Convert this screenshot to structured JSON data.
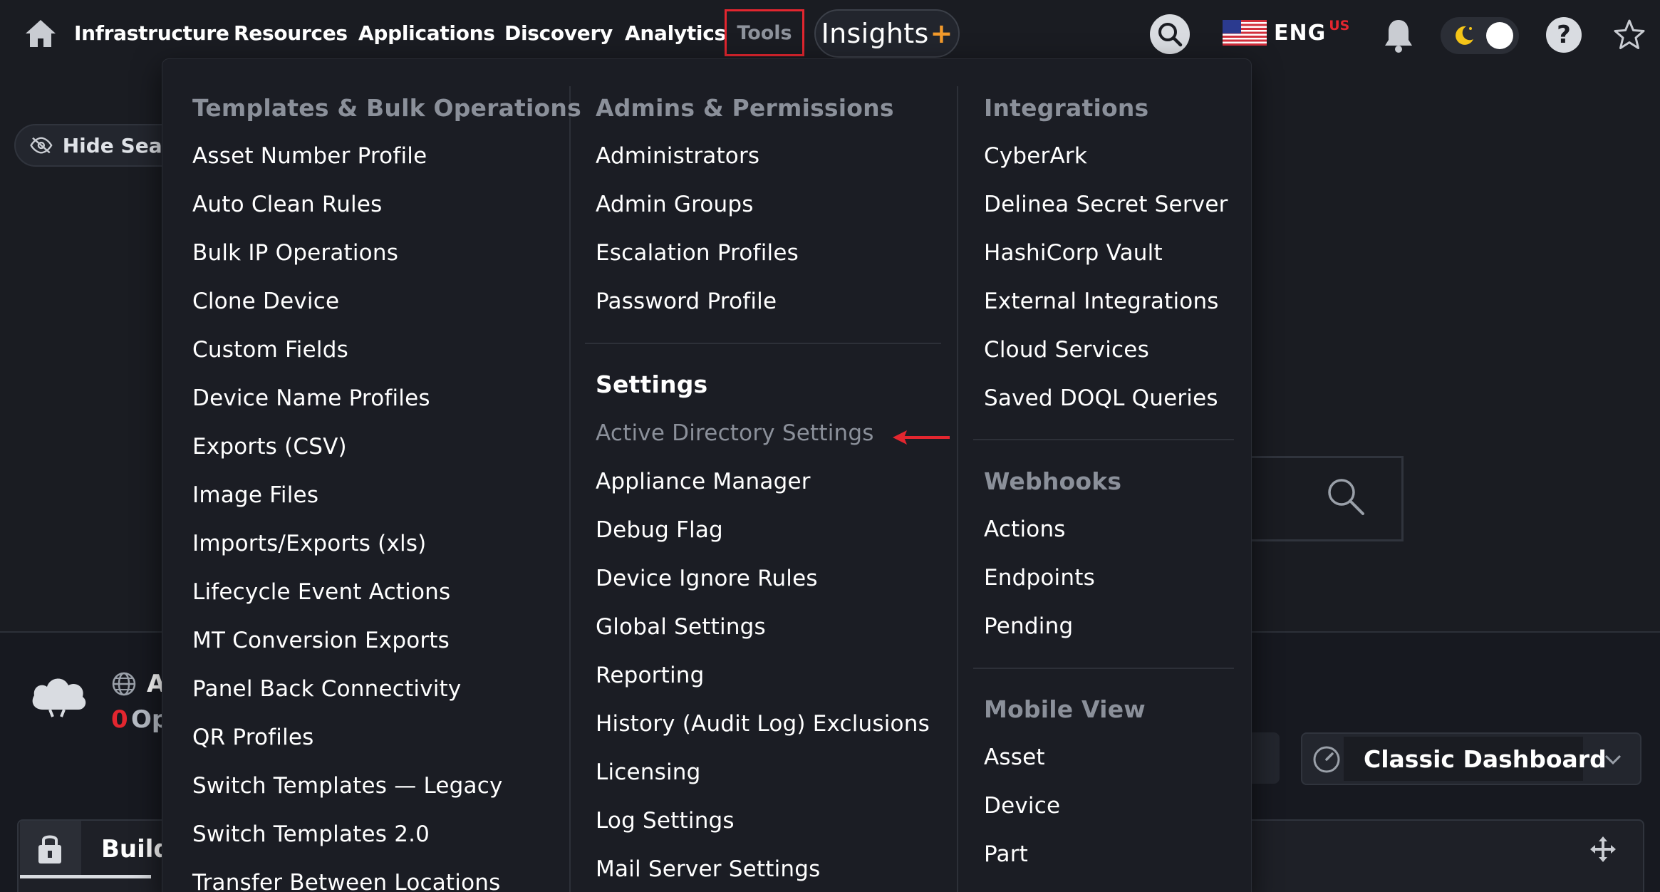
{
  "nav": {
    "items": [
      "Infrastructure",
      "Resources",
      "Applications",
      "Discovery",
      "Analytics"
    ],
    "tools_label": "Tools",
    "insights_label": "Insights",
    "insights_plus": "+",
    "language": "ENG",
    "region": "US",
    "help_glyph": "?"
  },
  "colors": {
    "accent_red": "#e3262f",
    "insights_plus": "#f39a2b",
    "background": "#1a1c22",
    "menu_header": "#8b909a"
  },
  "background": {
    "hide_search_label": "Hide Searc",
    "partial_title": "A",
    "count_value": "0",
    "count_label": "Op",
    "dashboard_label": "Classic Dashboard",
    "build_label": "Build"
  },
  "menu": {
    "col1": {
      "header": "Templates & Bulk Operations",
      "items": [
        "Asset Number Profile",
        "Auto Clean Rules",
        "Bulk IP Operations",
        "Clone Device",
        "Custom Fields",
        "Device Name Profiles",
        "Exports (CSV)",
        "Image Files",
        "Imports/Exports (xls)",
        "Lifecycle Event Actions",
        "MT Conversion Exports",
        "Panel Back Connectivity",
        "QR Profiles",
        "Switch Templates — Legacy",
        "Switch Templates 2.0",
        "Transfer Between Locations"
      ]
    },
    "col2": {
      "header": "Admins & Permissions",
      "items": [
        "Administrators",
        "Admin Groups",
        "Escalation Profiles",
        "Password Profile"
      ],
      "settings_header": "Settings",
      "settings_highlight": "Active Directory Settings",
      "settings_items": [
        "Appliance Manager",
        "Debug Flag",
        "Device Ignore Rules",
        "Global Settings",
        "Reporting",
        "History (Audit Log) Exclusions",
        "Licensing",
        "Log Settings",
        "Mail Server Settings"
      ]
    },
    "col3": {
      "header": "Integrations",
      "items": [
        "CyberArk",
        "Delinea Secret Server",
        "HashiCorp Vault",
        "External Integrations",
        "Cloud Services",
        "Saved DOQL Queries"
      ],
      "webhooks_header": "Webhooks",
      "webhooks_items": [
        "Actions",
        "Endpoints",
        "Pending"
      ],
      "mobile_header": "Mobile View",
      "mobile_items": [
        "Asset",
        "Device",
        "Part"
      ]
    }
  }
}
